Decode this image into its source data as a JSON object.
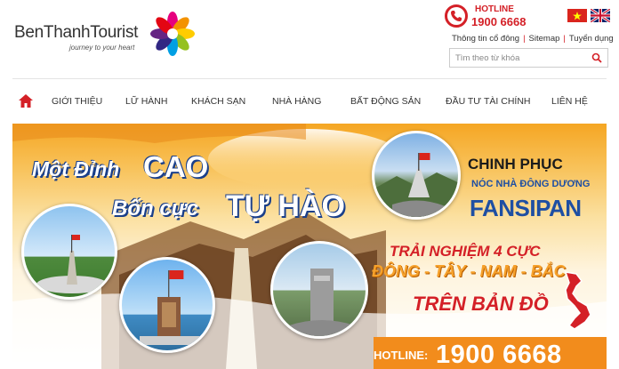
{
  "brand": {
    "name": "BenThanhTourist",
    "tagline": "journey to your heart"
  },
  "hotline": {
    "label": "HOTLINE",
    "number": "1900 6668"
  },
  "languages": [
    "Vietnamese flag",
    "English flag"
  ],
  "toplinks": [
    "Thông tin cổ đông",
    "Sitemap",
    "Tuyển dụng"
  ],
  "search": {
    "placeholder": "Tìm theo từ khóa"
  },
  "nav": {
    "items": [
      {
        "label": "GIỚI THIỆU"
      },
      {
        "label": "LỮ HÀNH"
      },
      {
        "label": "KHÁCH SẠN"
      },
      {
        "label": "NHÀ HÀNG"
      },
      {
        "label": "BẤT ĐỘNG SẢN"
      },
      {
        "label": "ĐẦU TƯ TÀI CHÍNH"
      },
      {
        "label": "LIÊN HỆ"
      }
    ]
  },
  "banner": {
    "line1a": "Một Đỉnh",
    "line1b": "CAO",
    "line2a": "Bốn cực",
    "line2b": "TỰ HÀO",
    "chinh_phuc": "CHINH PHỤC",
    "noc_nha": "NÓC NHÀ ĐÔNG DƯƠNG",
    "fansipan": "FANSIPAN",
    "trai_nghiem": "TRẢI NGHIỆM 4 CỰC",
    "directions": "ĐÔNG - TÂY - NAM - BẮC",
    "tren_ban_do": "TRÊN BẢN ĐỒ",
    "hotline_label": "HOTLINE:",
    "hotline_number": "1900 6668"
  },
  "colors": {
    "brand_red": "#d42027",
    "banner_orange": "#f28c1c",
    "fansipan_blue": "#1e4fa3"
  }
}
